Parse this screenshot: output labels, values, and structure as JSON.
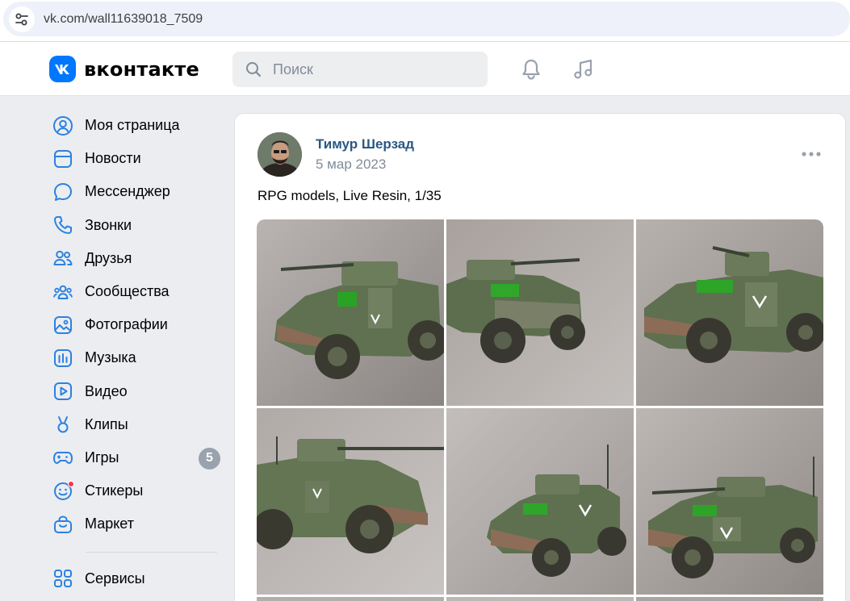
{
  "browser": {
    "url": "vk.com/wall11639018_7509"
  },
  "header": {
    "logo_text": "вконтакте",
    "search_placeholder": "Поиск",
    "brand_color": "#0077ff"
  },
  "sidebar": {
    "items": [
      {
        "label": "Моя страница",
        "icon": "user-circle-icon"
      },
      {
        "label": "Новости",
        "icon": "news-icon"
      },
      {
        "label": "Мессенджер",
        "icon": "message-icon"
      },
      {
        "label": "Звонки",
        "icon": "phone-icon"
      },
      {
        "label": "Друзья",
        "icon": "friends-icon"
      },
      {
        "label": "Сообщества",
        "icon": "communities-icon"
      },
      {
        "label": "Фотографии",
        "icon": "photos-icon"
      },
      {
        "label": "Музыка",
        "icon": "music-icon"
      },
      {
        "label": "Видео",
        "icon": "video-icon"
      },
      {
        "label": "Клипы",
        "icon": "clips-icon"
      },
      {
        "label": "Игры",
        "icon": "games-icon",
        "badge": "5"
      },
      {
        "label": "Стикеры",
        "icon": "stickers-icon"
      },
      {
        "label": "Маркет",
        "icon": "market-icon"
      }
    ],
    "services": {
      "label": "Сервисы",
      "icon": "services-icon"
    }
  },
  "post": {
    "author": "Тимур Шерзад",
    "date": "5 мар 2023",
    "text": "RPG models, Live Resin, 1/35",
    "link_color": "#2a5885",
    "photos": [
      {
        "index": 1,
        "subject": "armored-vehicle-model"
      },
      {
        "index": 2,
        "subject": "armored-vehicle-model"
      },
      {
        "index": 3,
        "subject": "armored-vehicle-model"
      },
      {
        "index": 4,
        "subject": "armored-vehicle-model"
      },
      {
        "index": 5,
        "subject": "armored-vehicle-model"
      },
      {
        "index": 6,
        "subject": "armored-vehicle-model"
      }
    ]
  }
}
